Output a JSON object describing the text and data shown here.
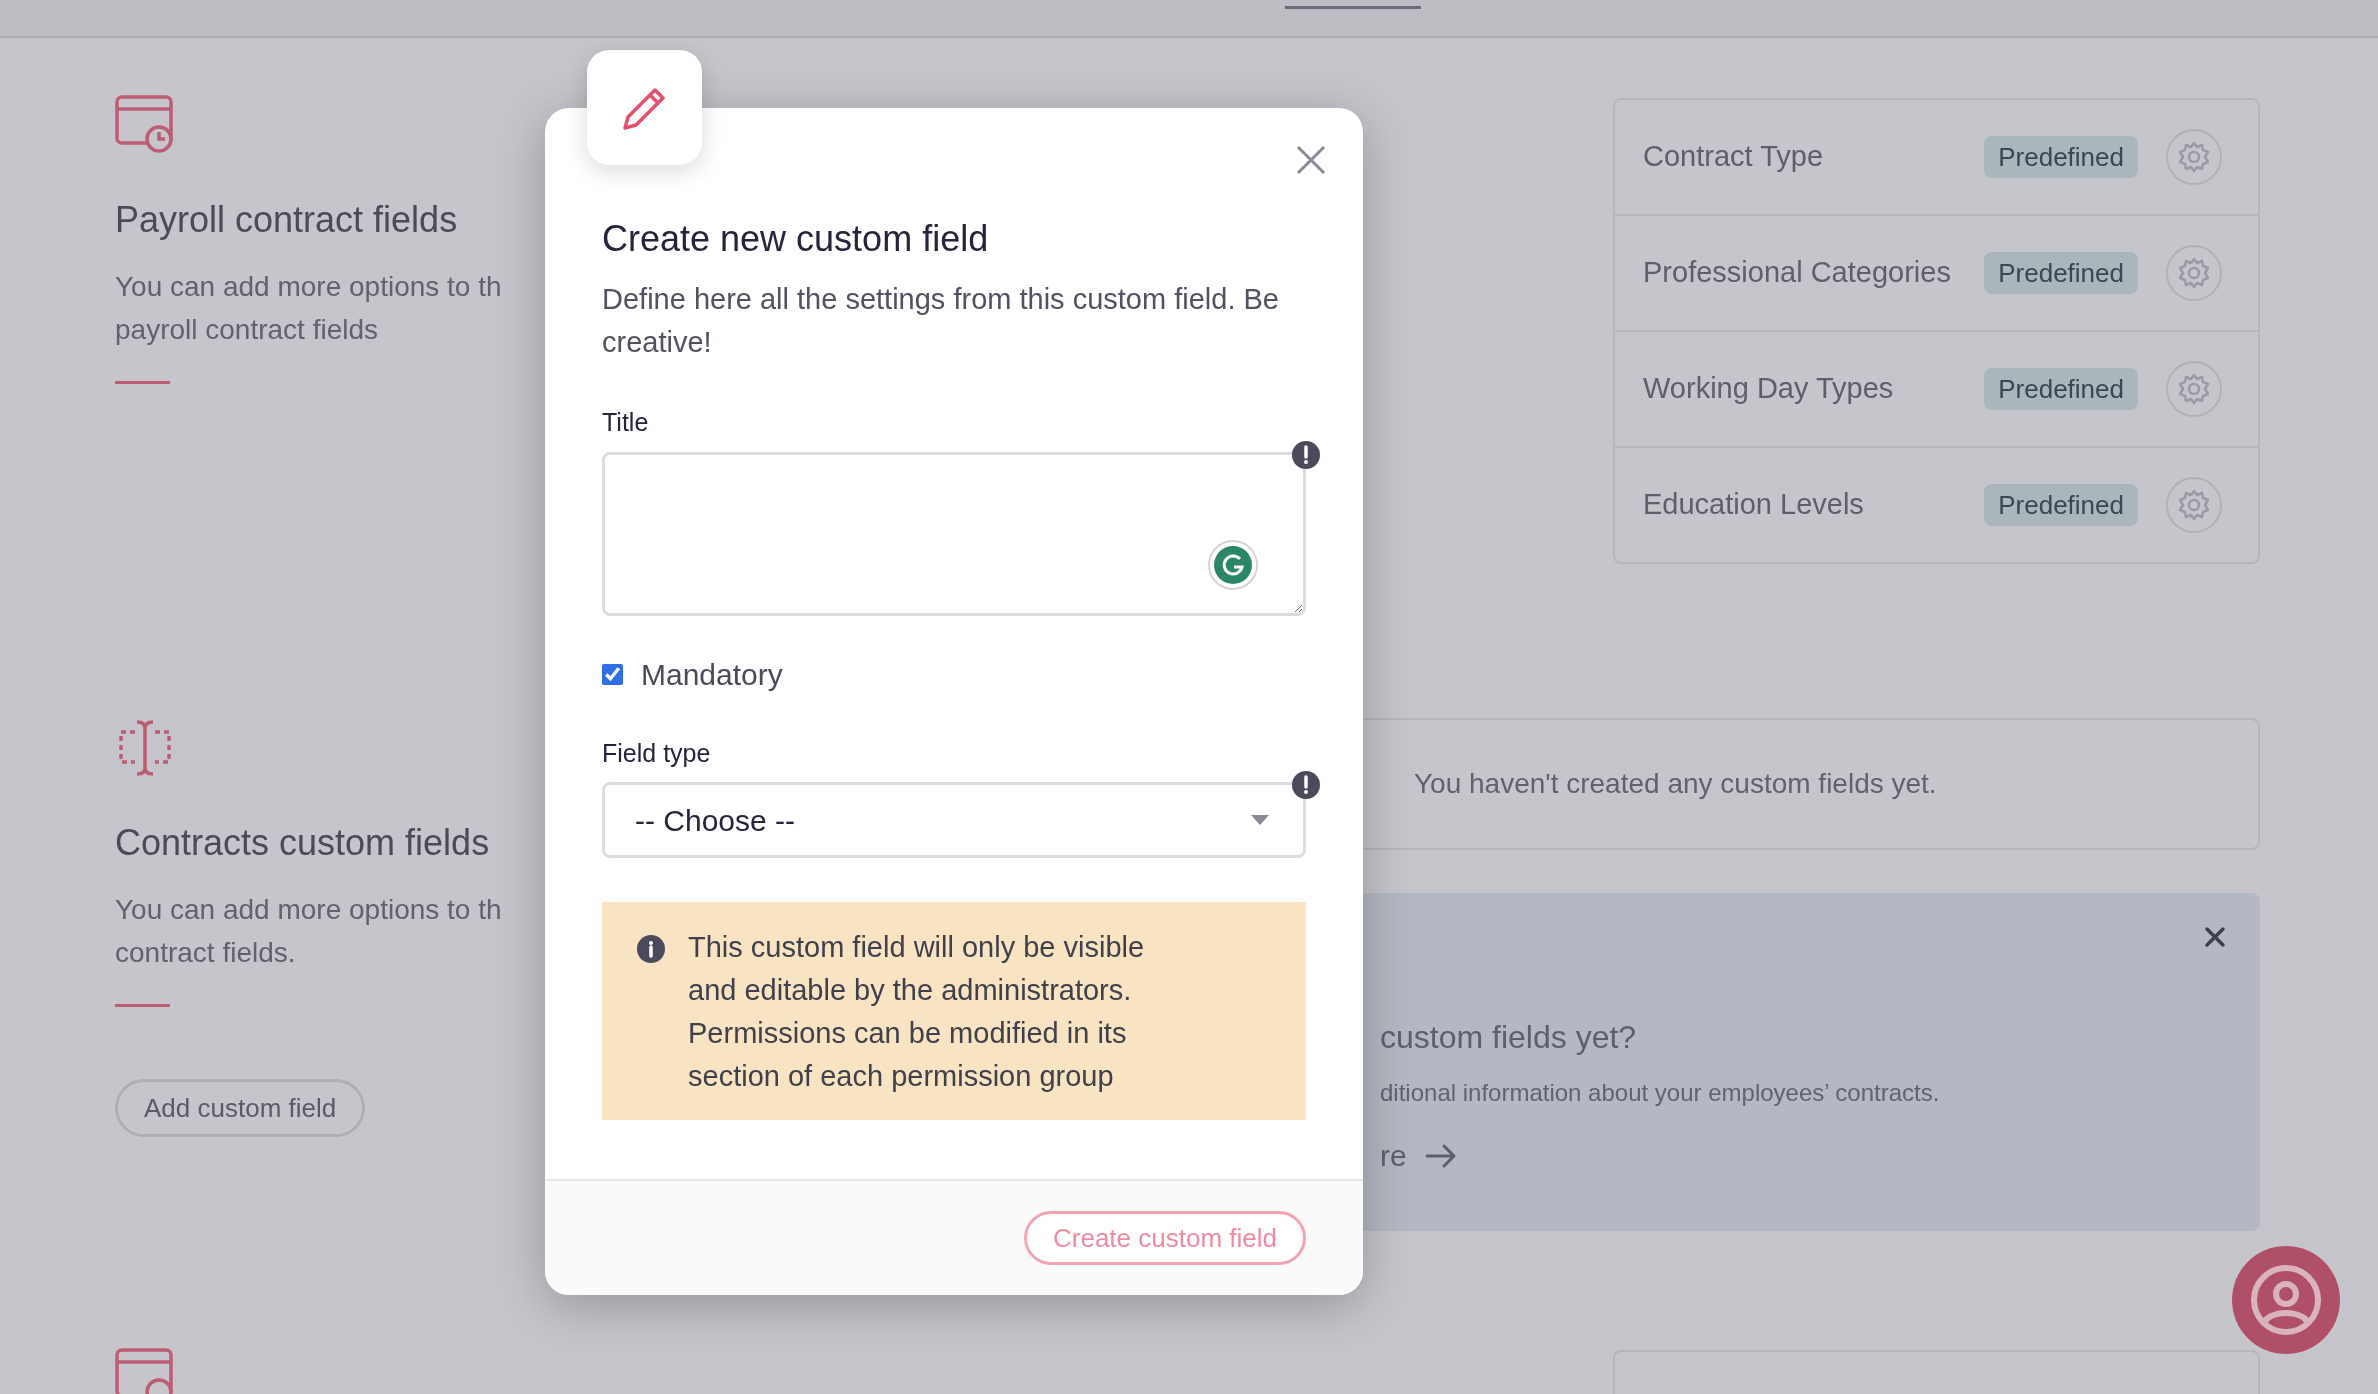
{
  "sections": [
    {
      "title": "Payroll contract fields",
      "description_lines": [
        "You can add more options to th",
        "payroll contract fields"
      ]
    },
    {
      "title": "Contracts custom fields",
      "description_lines": [
        "You can add more options to th",
        "contract fields."
      ],
      "button": "Add custom field"
    }
  ],
  "predefined_fields": [
    {
      "name": "Contract Type",
      "badge": "Predefined"
    },
    {
      "name": "Professional Categories",
      "badge": "Predefined"
    },
    {
      "name": "Working Day Types",
      "badge": "Predefined"
    },
    {
      "name": "Education Levels",
      "badge": "Predefined"
    }
  ],
  "empty_state": "You haven't created any custom fields yet.",
  "banner": {
    "title": "custom fields yet?",
    "text": "ditional information about your employees’ contracts.",
    "link": "re"
  },
  "modal": {
    "title": "Create new custom field",
    "description": "Define here all the settings from this custom field. Be creative!",
    "title_field": {
      "label": "Title",
      "required": true
    },
    "mandatory": {
      "label": "Mandatory",
      "checked": true
    },
    "field_type": {
      "label": "Field type",
      "value": "-- Choose --",
      "required": true
    },
    "notice": "This custom field will only be visible and editable by the administrators. Permissions can be modified in its section of each permission group",
    "submit": {
      "label": "Create custom field",
      "disabled": true
    }
  }
}
